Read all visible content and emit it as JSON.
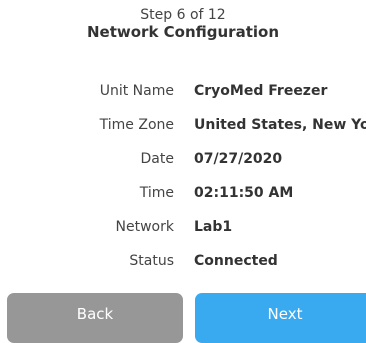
{
  "header": {
    "step": "Step 6 of 12",
    "title": "Network Configuration"
  },
  "info": [
    {
      "label": "Unit Name",
      "value": "CryoMed Freezer"
    },
    {
      "label": "Time Zone",
      "value": "United States, New Yor"
    },
    {
      "label": "Date",
      "value": "07/27/2020"
    },
    {
      "label": "Time",
      "value": "02:11:50 AM"
    },
    {
      "label": "Network",
      "value": "Lab1"
    },
    {
      "label": "Status",
      "value": "Connected"
    }
  ],
  "buttons": {
    "back": "Back",
    "next": "Next"
  },
  "colors": {
    "back_button": "#979797",
    "next_button": "#3aaaf0"
  }
}
